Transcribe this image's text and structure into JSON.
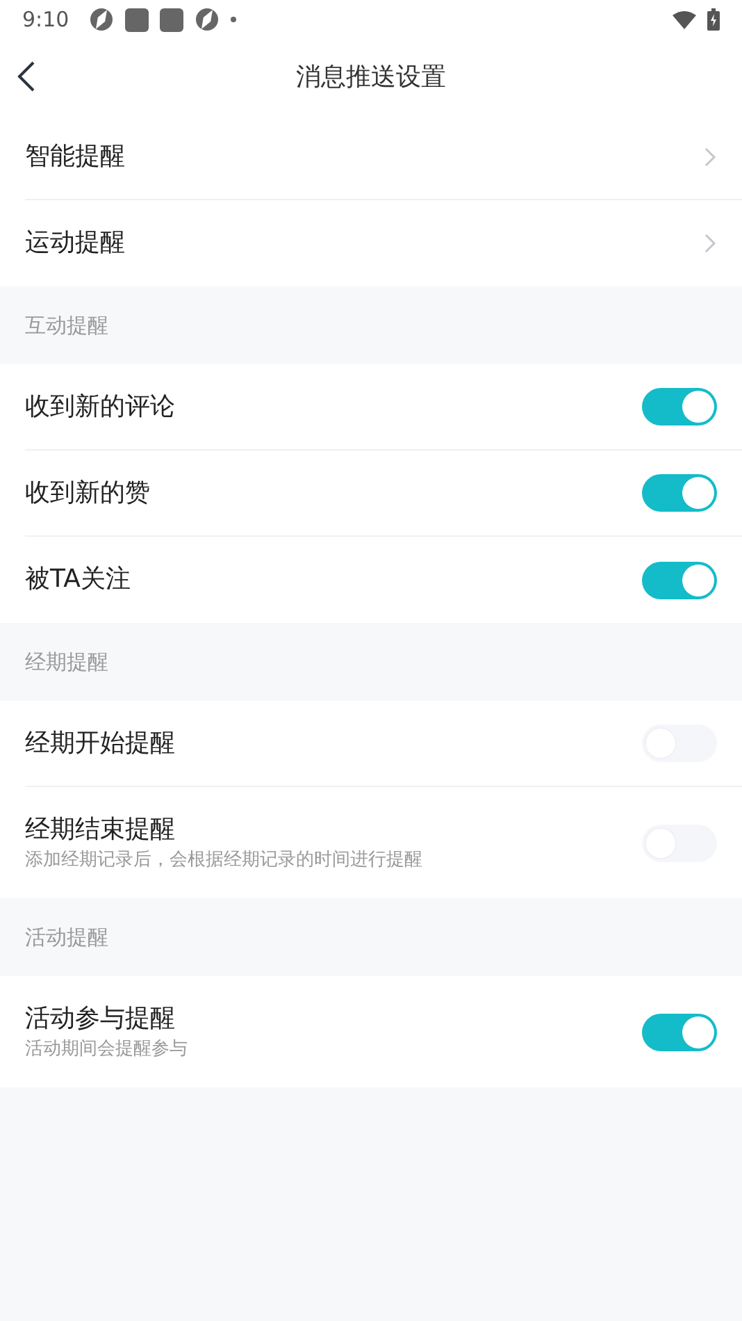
{
  "status_bar": {
    "time": "9:10"
  },
  "header": {
    "title": "消息推送设置"
  },
  "sections": [
    {
      "rows": [
        {
          "kind": "link",
          "label": "智能提醒"
        },
        {
          "kind": "link",
          "label": "运动提醒"
        }
      ]
    },
    {
      "header": "互动提醒",
      "rows": [
        {
          "kind": "toggle",
          "label": "收到新的评论",
          "on": true
        },
        {
          "kind": "toggle",
          "label": "收到新的赞",
          "on": true
        },
        {
          "kind": "toggle",
          "label": "被TA关注",
          "on": true
        }
      ]
    },
    {
      "header": "经期提醒",
      "rows": [
        {
          "kind": "toggle",
          "label": "经期开始提醒",
          "on": false
        },
        {
          "kind": "toggle",
          "label": "经期结束提醒",
          "subtitle": "添加经期记录后，会根据经期记录的时间进行提醒",
          "on": false
        }
      ]
    },
    {
      "header": "活动提醒",
      "rows": [
        {
          "kind": "toggle",
          "label": "活动参与提醒",
          "subtitle": "活动期间会提醒参与",
          "on": true
        }
      ]
    }
  ]
}
